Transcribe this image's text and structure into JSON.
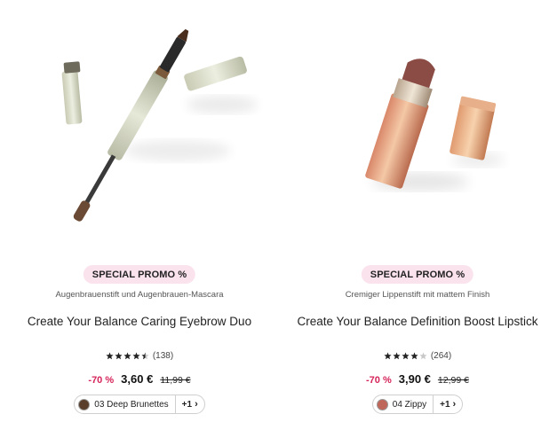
{
  "products": [
    {
      "badge": "SPECIAL PROMO %",
      "subtitle": "Augenbrauenstift und Augenbrauen-Mascara",
      "title": "Create Your Balance Caring Eyebrow Duo",
      "rating_value": 4.5,
      "review_count": "(138)",
      "discount": "-70 %",
      "price": "3,60 €",
      "old_price": "11,99 €",
      "shade_name": "03 Deep Brunettes",
      "shade_color": "#5a3e2b",
      "more_shades": "+1",
      "chevron": "›"
    },
    {
      "badge": "SPECIAL PROMO %",
      "subtitle": "Cremiger Lippenstift mit mattem Finish",
      "title": "Create Your Balance Definition Boost Lipstick",
      "rating_value": 4,
      "review_count": "(264)",
      "discount": "-70 %",
      "price": "3,90 €",
      "old_price": "12,99 €",
      "shade_name": "04 Zippy",
      "shade_color": "#c0675c",
      "more_shades": "+1",
      "chevron": "›"
    }
  ],
  "colors": {
    "badge_bg": "#fbe3ee",
    "discount": "#d6245a",
    "star": "#222222",
    "star_empty": "#c8c8c8"
  }
}
